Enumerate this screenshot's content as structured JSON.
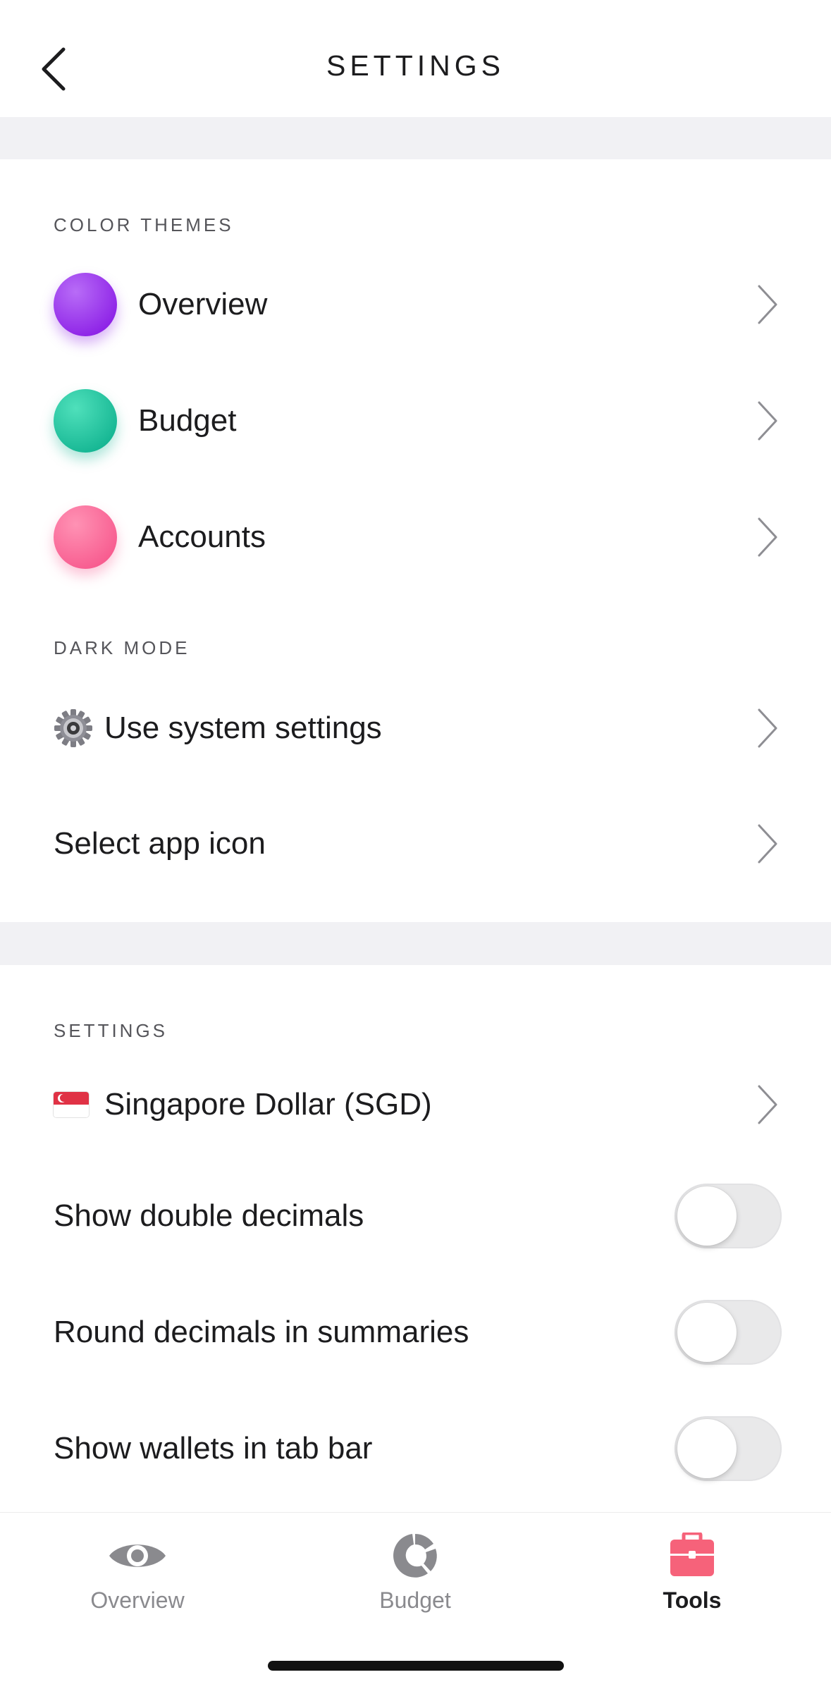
{
  "header": {
    "title": "SETTINGS"
  },
  "color_themes": {
    "section_label": "COLOR THEMES",
    "items": [
      {
        "label": "Overview",
        "color": "#9b30ee"
      },
      {
        "label": "Budget",
        "color": "#1ec7a0"
      },
      {
        "label": "Accounts",
        "color": "#f9699a"
      }
    ]
  },
  "dark_mode": {
    "section_label": "DARK MODE",
    "value_label": "Use system settings",
    "icon": "gear-icon"
  },
  "app_icon": {
    "label": "Select app icon"
  },
  "settings": {
    "section_label": "SETTINGS",
    "currency": {
      "label": "Singapore Dollar (SGD)",
      "icon": "singapore-flag-icon"
    },
    "toggles": [
      {
        "label": "Show double decimals",
        "on": false
      },
      {
        "label": "Round decimals in summaries",
        "on": false
      },
      {
        "label": "Show wallets in tab bar",
        "on": false
      }
    ]
  },
  "tabbar": {
    "tabs": [
      {
        "label": "Overview",
        "icon": "eye-icon",
        "active": false
      },
      {
        "label": "Budget",
        "icon": "donut-chart-icon",
        "active": false
      },
      {
        "label": "Tools",
        "icon": "toolbox-icon",
        "active": true
      }
    ],
    "active_color": "#f6627a",
    "inactive_color": "#8a8a8e"
  }
}
